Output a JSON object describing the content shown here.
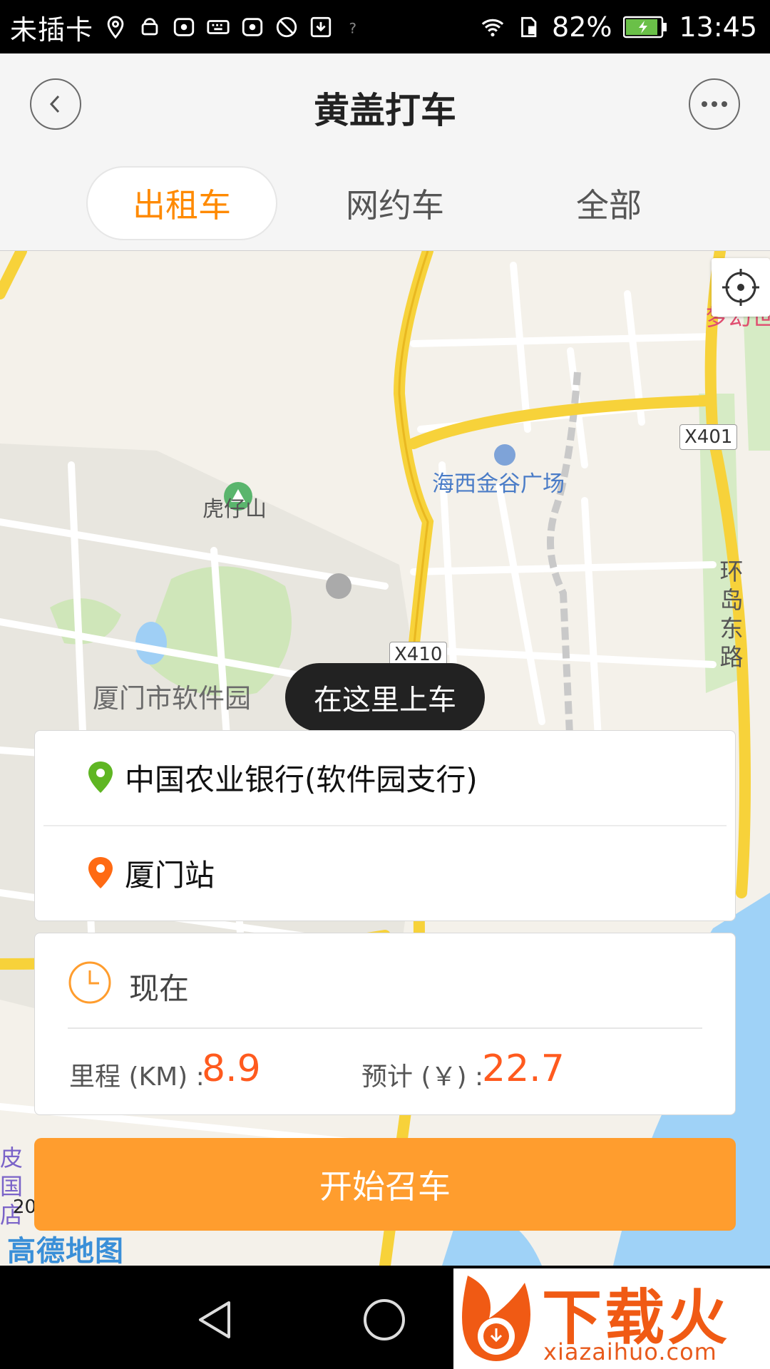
{
  "status_bar": {
    "carrier": "未插卡",
    "battery_percent": "82%",
    "time": "13:45",
    "icons": [
      "location-icon",
      "android-icon",
      "huawei-icon",
      "keyboard-icon",
      "huawei-icon",
      "no-sim-icon",
      "download-icon",
      "wifi-question-icon",
      "wifi-icon",
      "sim-icon",
      "battery-icon"
    ]
  },
  "header": {
    "title": "黄盖打车",
    "back_icon": "chevron-left-icon",
    "more_icon": "more-dots-icon"
  },
  "tabs": [
    {
      "label": "出租车",
      "active": true
    },
    {
      "label": "网约车",
      "active": false
    },
    {
      "label": "全部",
      "active": false
    }
  ],
  "map": {
    "labels": {
      "park": "虎仔山",
      "plaza": "海西金谷广场",
      "software_park": "厦门市软件园",
      "road_east": "环岛东路",
      "pink_poi": "梦幻世",
      "left_poi": "皮国店"
    },
    "road_shields": [
      "X401",
      "X410"
    ],
    "pickup_bubble": "在这里上车",
    "scale_number": "20",
    "provider_logo": "高德地图",
    "locate_icon": "locate-crosshair-icon"
  },
  "trip": {
    "start": "中国农业银行(软件园支行)",
    "end": "厦门站",
    "time": "现在",
    "distance_label": "里程 (KM) :",
    "distance_value": "8.9",
    "fare_label": "预计 (￥) :",
    "fare_value": "22.7"
  },
  "actions": {
    "call_button": "开始召车"
  },
  "colors": {
    "accent_orange": "#ff8a00",
    "button_orange": "#ff9d2e",
    "value_red": "#ff5a1e",
    "start_pin_green": "#5fb623",
    "end_pin_orange": "#ff6a13"
  },
  "watermark": {
    "brand": "下载火",
    "url": "xiazaihuo.com"
  }
}
